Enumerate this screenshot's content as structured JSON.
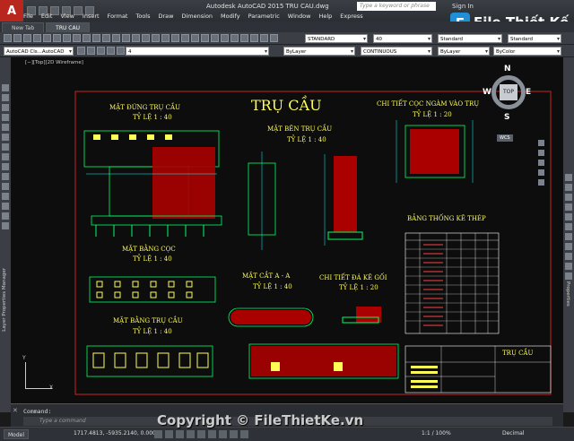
{
  "window": {
    "title": "Autodesk AutoCAD 2015   TRU CAU.dwg",
    "search_placeholder": "Type a keyword or phrase",
    "signin": "Sign In"
  },
  "menu": [
    "File",
    "Edit",
    "View",
    "Insert",
    "Format",
    "Tools",
    "Draw",
    "Dimension",
    "Modify",
    "Parametric",
    "Window",
    "Help",
    "Express"
  ],
  "tabs": [
    {
      "label": "New Tab",
      "active": false
    },
    {
      "label": "TRU CAU",
      "active": true
    }
  ],
  "toolbar1": {
    "textstyle": "STANDARD",
    "textheight": "40",
    "dimstyle": "Standard",
    "tablestyle": "Standard"
  },
  "toolbar2": {
    "workspace": "AutoCAD Cls...AutoCAD 201",
    "layer_num": "4",
    "color": "ByLayer",
    "linetype": "CONTINUOUS",
    "lineweight": "ByLayer",
    "plotstyle": "ByColor"
  },
  "viewport_label": "[−][Top][2D Wireframe]",
  "left_palette_label": "Layer Properties Manager",
  "right_palette_label": "Properties",
  "viewcube": {
    "top": "TOP",
    "n": "N",
    "s": "S",
    "w": "W",
    "e": "E",
    "wcs": "WCS"
  },
  "drawing": {
    "main_title": "TRỤ CẦU",
    "front_title": "MẶT ĐỨNG TRỤ CẦU",
    "front_scale": "TỶ LỆ 1 : 40",
    "side_title": "MẶT BÊN TRỤ CẦU",
    "side_scale": "TỶ LỆ 1 : 40",
    "pile_detail_title": "CHI TIẾT CỌC NGÀM VÀO TRỤ",
    "pile_detail_scale": "TỶ LỆ 1 : 20",
    "pile_plan_title": "MẶT BẰNG CỌC",
    "pile_plan_scale": "TỶ LỆ 1 : 40",
    "section_title": "MẶT CẮT A - A",
    "section_scale": "TỶ LỆ 1 : 40",
    "bearing_title": "CHI TIẾT ĐÁ KÊ GỐI",
    "bearing_scale": "TỶ LỆ 1 : 20",
    "steel_table_title": "BẢNG THỐNG KÊ THÉP",
    "plan_title": "MẶT BẰNG TRỤ CẦU",
    "plan_scale": "TỶ LỆ 1 : 40",
    "titleblock_name": "TRỤ CẦU"
  },
  "ucs": {
    "x": "X",
    "y": "Y"
  },
  "command": {
    "label": "Command:",
    "placeholder": "Type a command"
  },
  "status": {
    "model_tab": "Model",
    "coords": "1717.4813, -5935.2140, 0.0000",
    "scale": "1:1 / 100%",
    "units": "Decimal"
  },
  "watermark": "Copyright © FileThietKe.vn",
  "logo": {
    "badge": "F",
    "text": "File Thiết Kế.vn"
  }
}
